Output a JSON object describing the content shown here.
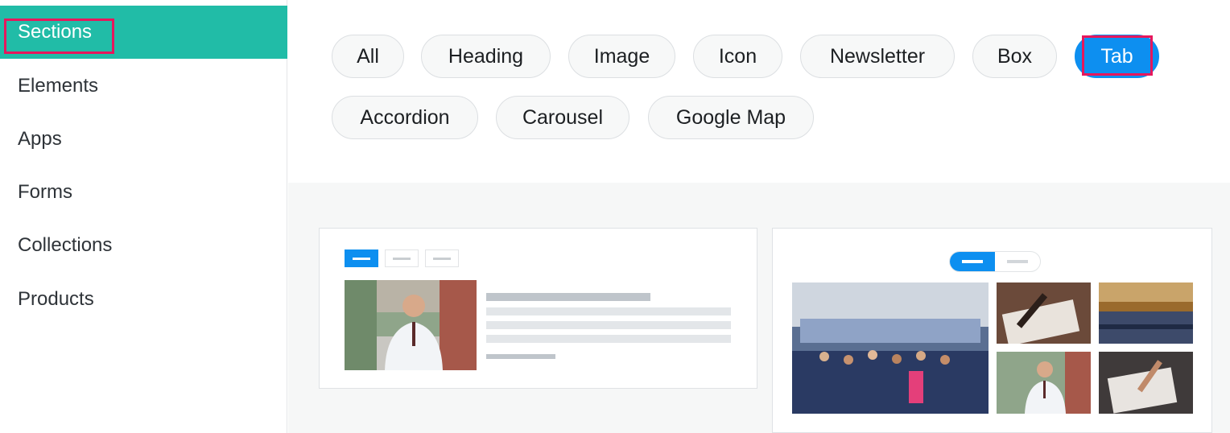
{
  "sidebar": {
    "items": [
      {
        "label": "Sections",
        "active": true
      },
      {
        "label": "Elements"
      },
      {
        "label": "Apps"
      },
      {
        "label": "Forms"
      },
      {
        "label": "Collections"
      },
      {
        "label": "Products"
      }
    ]
  },
  "filters": {
    "chips": [
      {
        "label": "All"
      },
      {
        "label": "Heading"
      },
      {
        "label": "Image"
      },
      {
        "label": "Icon"
      },
      {
        "label": "Newsletter"
      },
      {
        "label": "Box"
      },
      {
        "label": "Tab",
        "active": true
      },
      {
        "label": "Accordion"
      },
      {
        "label": "Carousel"
      },
      {
        "label": "Google Map"
      }
    ]
  },
  "templates": [
    {
      "name": "tab-template-with-text"
    },
    {
      "name": "tab-template-gallery"
    }
  ],
  "colors": {
    "sidebar_active": "#21bca7",
    "chip_active": "#0d8ff0",
    "highlight": "#e6175c"
  }
}
